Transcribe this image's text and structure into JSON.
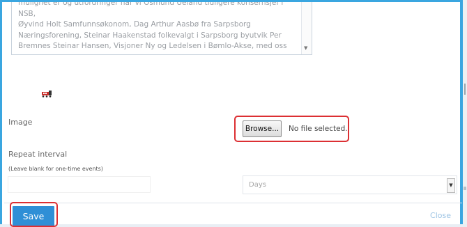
{
  "description": {
    "lines": [
      "mulighet er og utfordringer har vi Osmund Ueland tidligere konsernsjef i NSB,",
      "Øyvind Holt Samfunnsøkonom, Dag Arthur Aasbø fra Sarpsborg",
      "Næringsforening, Steinar Haakenstad folkevalgt i Sarpsborg byutvik Per",
      "Bremnes Steinar Hansen, Visjoner Ny og Ledelsen i Bømlo-Akse, med oss"
    ]
  },
  "image": {
    "label": "Image",
    "browse_label": "Browse...",
    "file_status": "No file selected."
  },
  "repeat": {
    "label": "Repeat interval",
    "hint": "(Leave blank for one-time events)",
    "value": "",
    "unit_selected": "Days"
  },
  "footer": {
    "save_label": "Save",
    "close_label": "Close"
  },
  "icons": {
    "event_icon": "train-icon",
    "select_arrow": "chevron-down-icon"
  },
  "colors": {
    "save_button": "#2f8fd6",
    "highlight": "#dc2f33",
    "frame_border": "#3aa6e0",
    "close_link": "#9ec4e4"
  }
}
